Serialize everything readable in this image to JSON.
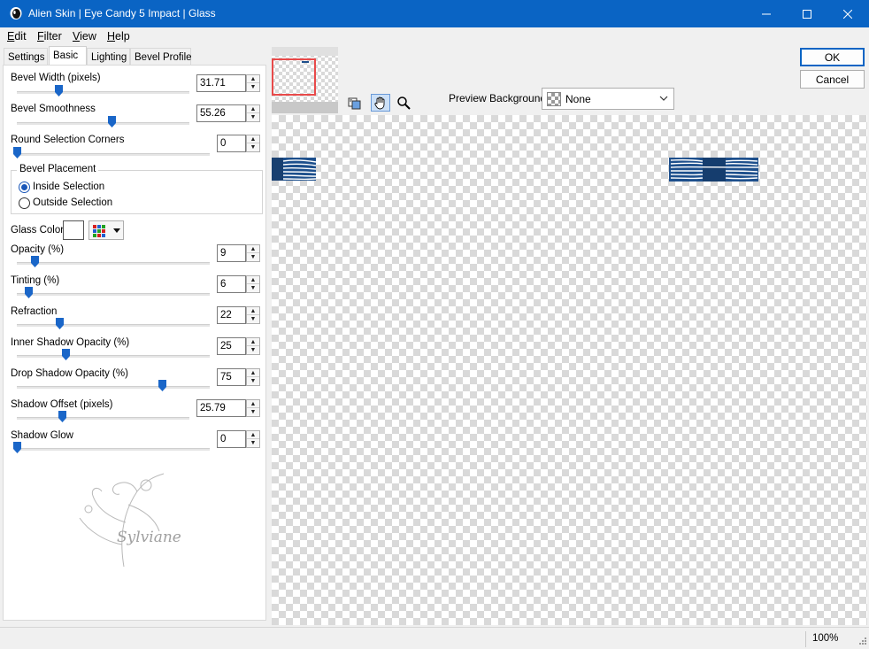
{
  "window": {
    "title": "Alien Skin | Eye Candy 5 Impact | Glass"
  },
  "menu": [
    {
      "label": "Edit",
      "mnemonic": "E",
      "rest": "dit"
    },
    {
      "label": "Filter",
      "mnemonic": "F",
      "rest": "ilter"
    },
    {
      "label": "View",
      "mnemonic": "V",
      "rest": "iew"
    },
    {
      "label": "Help",
      "mnemonic": "H",
      "rest": "elp"
    }
  ],
  "tabs": [
    "Settings",
    "Basic",
    "Lighting",
    "Bevel Profile"
  ],
  "active_tab": "Basic",
  "controls": {
    "bevel_width": {
      "label": "Bevel Width (pixels)",
      "value": "31.71",
      "level": 0.24
    },
    "bevel_smoothness": {
      "label": "Bevel Smoothness",
      "value": "55.26",
      "level": 0.55
    },
    "round_corners": {
      "label": "Round Selection Corners",
      "value": "0",
      "level": 0.0
    },
    "bevel_placement": {
      "legend": "Bevel Placement",
      "inside": "Inside Selection",
      "outside": "Outside Selection",
      "selected": "inside"
    },
    "glass_color": {
      "label": "Glass Color",
      "color": "#ffffff"
    },
    "opacity": {
      "label": "Opacity (%)",
      "value": "9",
      "level": 0.09
    },
    "tinting": {
      "label": "Tinting (%)",
      "value": "6",
      "level": 0.06
    },
    "refraction": {
      "label": "Refraction",
      "value": "22",
      "level": 0.22
    },
    "inner_shadow_opacity": {
      "label": "Inner Shadow Opacity (%)",
      "value": "25",
      "level": 0.25
    },
    "drop_shadow_opacity": {
      "label": "Drop Shadow Opacity (%)",
      "value": "75",
      "level": 0.75
    },
    "shadow_offset": {
      "label": "Shadow Offset (pixels)",
      "value": "25.79",
      "level": 0.26
    },
    "shadow_glow": {
      "label": "Shadow Glow",
      "value": "0",
      "level": 0.0
    }
  },
  "preview": {
    "background_label": "Preview Background:",
    "background_value": "None",
    "tools": [
      "preview-bg-icon",
      "hand-icon",
      "zoom-icon"
    ],
    "active_tool": "hand-icon"
  },
  "buttons": {
    "ok": "OK",
    "cancel": "Cancel"
  },
  "status": {
    "zoom": "100%"
  },
  "watermark": {
    "text": "Sylviane"
  },
  "colors": {
    "titlebar": "#0a64c4",
    "accent": "#1a57b8",
    "bevel_blue": "#1d4f8c"
  }
}
